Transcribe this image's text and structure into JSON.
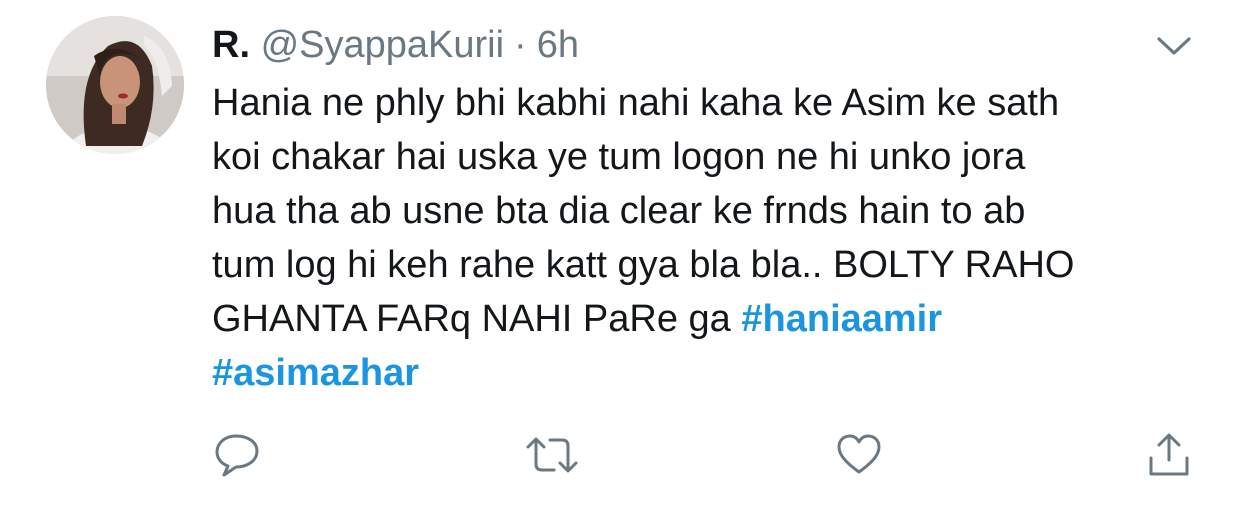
{
  "tweet": {
    "display_name": "R.",
    "handle": "@SyappaKurii",
    "separator": "·",
    "time": "6h",
    "text_lines": [
      "Hania ne phly bhi kabhi nahi kaha ke Asim ke sath",
      "koi chakar hai uska ye tum logon ne hi unko jora",
      "hua tha ab usne bta dia clear ke frnds hain to ab",
      "tum log hi keh rahe katt gya bla bla.. BOLTY RAHO",
      "GHANTA FARq NAHI PaRe ga "
    ],
    "hashtags": [
      "#haniaamir",
      "#asimazhar"
    ]
  },
  "icons": {
    "menu": "chevron-down-icon",
    "reply": "reply-bubble-icon",
    "retweet": "retweet-icon",
    "like": "heart-icon",
    "share": "share-icon"
  },
  "colors": {
    "text": "#14171a",
    "secondary": "#697882",
    "hashtag": "#1b95e0",
    "icon": "#697882"
  }
}
